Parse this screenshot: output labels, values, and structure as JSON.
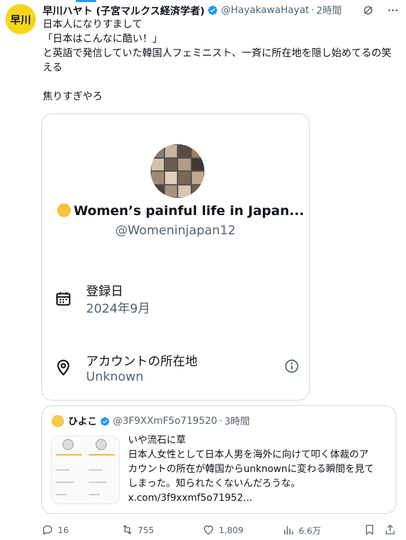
{
  "author": {
    "avatar_text": "早川",
    "name": "早川ハヤト (子宮マルクス経済学者)",
    "handle": "@HayakawaHayat",
    "time": "2時間",
    "verified": true
  },
  "tweet": {
    "lines": [
      "日本人になりすまして",
      "「日本はこんなに酷い！」",
      "と英語で発信していた韓国人フェミニスト、一斉に所在地を隠し始めてるの笑",
      "える",
      "",
      "焦りすぎやろ"
    ]
  },
  "profile_card": {
    "display_name": "Women’s painful life in Japan...",
    "handle": "@Womeninjapan12",
    "joined_label": "登録日",
    "joined_value": "2024年9月",
    "location_label": "アカウントの所在地",
    "location_value": "Unknown"
  },
  "quote": {
    "name": "ひよこ",
    "handle": "@3F9XXmF5o719520",
    "time": "3時間",
    "lines": [
      "いや流石に草",
      "日本人女性として日本人男を海外に向けて叩く体裁のア",
      "カウントの所在が韓国からunknownに変わる瞬間を見て",
      "しまった。知られたくないんだろうな。",
      "x.com/3f9xxmf5o71952..."
    ]
  },
  "actions": {
    "replies": "16",
    "reposts": "755",
    "likes": "1,809",
    "views": "6.6万"
  },
  "colors": {
    "accent": "#1d9bf0",
    "muted": "#536471",
    "border": "#cfd9de",
    "avatar_bg": "#f7d51d"
  }
}
